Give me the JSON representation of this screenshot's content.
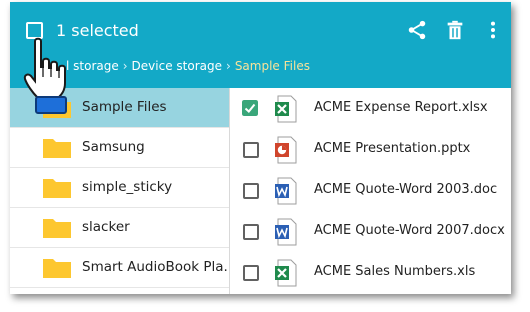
{
  "header": {
    "title": "1 selected",
    "actions": [
      {
        "icon": "share-icon"
      },
      {
        "icon": "trash-icon"
      },
      {
        "icon": "more-vert-icon"
      }
    ],
    "breadcrumb": [
      "l storage",
      "Device storage",
      "Sample Files"
    ]
  },
  "folders": [
    {
      "label": "Sample Files",
      "selected": true
    },
    {
      "label": "Samsung",
      "selected": false
    },
    {
      "label": "simple_sticky",
      "selected": false
    },
    {
      "label": "slacker",
      "selected": false
    },
    {
      "label": "Smart AudioBook Pla...",
      "selected": false
    }
  ],
  "files": [
    {
      "label": "ACME Expense Report.xlsx",
      "type": "excel",
      "checked": true
    },
    {
      "label": "ACME Presentation.pptx",
      "type": "powerpoint",
      "checked": false
    },
    {
      "label": "ACME Quote-Word 2003.doc",
      "type": "word",
      "checked": false
    },
    {
      "label": "ACME Quote-Word 2007.docx",
      "type": "word",
      "checked": false
    },
    {
      "label": "ACME Sales Numbers.xls",
      "type": "excel",
      "checked": false
    }
  ],
  "colors": {
    "appbar": "#13a9c7",
    "selected_folder": "#97d4e0",
    "folder": "#fdc72f",
    "checkbox_checked": "#3aa67a",
    "excel": "#1f8a4c",
    "powerpoint": "#d0452c",
    "word": "#2b5fb4"
  }
}
